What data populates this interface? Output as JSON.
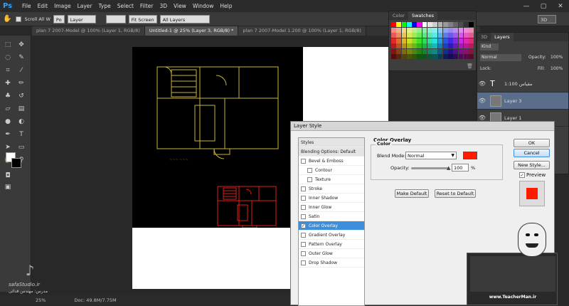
{
  "app": {
    "logo": "Ps"
  },
  "menu": [
    "File",
    "Edit",
    "Image",
    "Layer",
    "Type",
    "Select",
    "Filter",
    "3D",
    "View",
    "Window",
    "Help"
  ],
  "window_controls": [
    "—",
    "▢",
    "✕"
  ],
  "options_bar": {
    "scroll_all": "Scroll All W",
    "fit_screen": "Fit Screen",
    "layer_select_label": "Po",
    "layer_select_value": "Layer",
    "all_layers": "All Layers",
    "workspace": "3D"
  },
  "doc_tabs": [
    {
      "label": "plan 7 2007-Model @ 100% (Layer 1, RGB/8)",
      "active": false
    },
    {
      "label": "Untitled-1 @ 25% (Layer 3, RGB/8) *",
      "active": true
    },
    {
      "label": "plan 7 2007-Model 1.200 @ 100% (Layer 1, RGB/8)",
      "active": false
    }
  ],
  "status": {
    "zoom": "25%",
    "doc": "Doc: 49.8M/7.75M"
  },
  "swatches_panel": {
    "tabs": [
      "Color",
      "Swatches"
    ],
    "active": "Swatches"
  },
  "layers_panel": {
    "tabs": [
      "3D",
      "Layers"
    ],
    "kind": "Kind",
    "blend": "Normal",
    "opacity_label": "Opacity:",
    "opacity": "100%",
    "lock_label": "Lock:",
    "fill_label": "Fill:",
    "fill": "100%",
    "layers": [
      {
        "name": "1:100 مقیاس",
        "type": "text",
        "selected": false
      },
      {
        "name": "Layer 3",
        "type": "pixel",
        "selected": true
      },
      {
        "name": "Layer 1",
        "type": "pixel",
        "selected": false
      }
    ]
  },
  "dialog": {
    "title": "Layer Style",
    "styles_header": "Styles",
    "blending_options": "Blending Options: Default",
    "styles": [
      {
        "label": "Bevel & Emboss",
        "checked": false,
        "sub": false
      },
      {
        "label": "Contour",
        "checked": false,
        "sub": true
      },
      {
        "label": "Texture",
        "checked": false,
        "sub": true
      },
      {
        "label": "Stroke",
        "checked": false,
        "sub": false
      },
      {
        "label": "Inner Shadow",
        "checked": false,
        "sub": false
      },
      {
        "label": "Inner Glow",
        "checked": false,
        "sub": false
      },
      {
        "label": "Satin",
        "checked": false,
        "sub": false
      },
      {
        "label": "Color Overlay",
        "checked": true,
        "sub": false,
        "selected": true
      },
      {
        "label": "Gradient Overlay",
        "checked": false,
        "sub": false
      },
      {
        "label": "Pattern Overlay",
        "checked": false,
        "sub": false
      },
      {
        "label": "Outer Glow",
        "checked": false,
        "sub": false
      },
      {
        "label": "Drop Shadow",
        "checked": false,
        "sub": false
      }
    ],
    "section_title": "Color Overlay",
    "group_title": "Color",
    "blend_mode_label": "Blend Mode:",
    "blend_mode_value": "Normal",
    "opacity_label": "Opacity:",
    "opacity_value": "100",
    "opacity_unit": "%",
    "overlay_color": "#ff1a00",
    "make_default": "Make Default",
    "reset_default": "Reset to Default",
    "ok": "OK",
    "cancel": "Cancel",
    "new_style": "New Style...",
    "preview": "Preview"
  },
  "watermark": {
    "brand": "safaStudio.ir",
    "credit": "مدرس: مهندس قدائی",
    "teacher": "www.TeacherMan.ir"
  },
  "colors": {
    "accent": "#3d8fdc",
    "plan_yellow": "#c8b43a",
    "plan_red": "#e0201a"
  }
}
